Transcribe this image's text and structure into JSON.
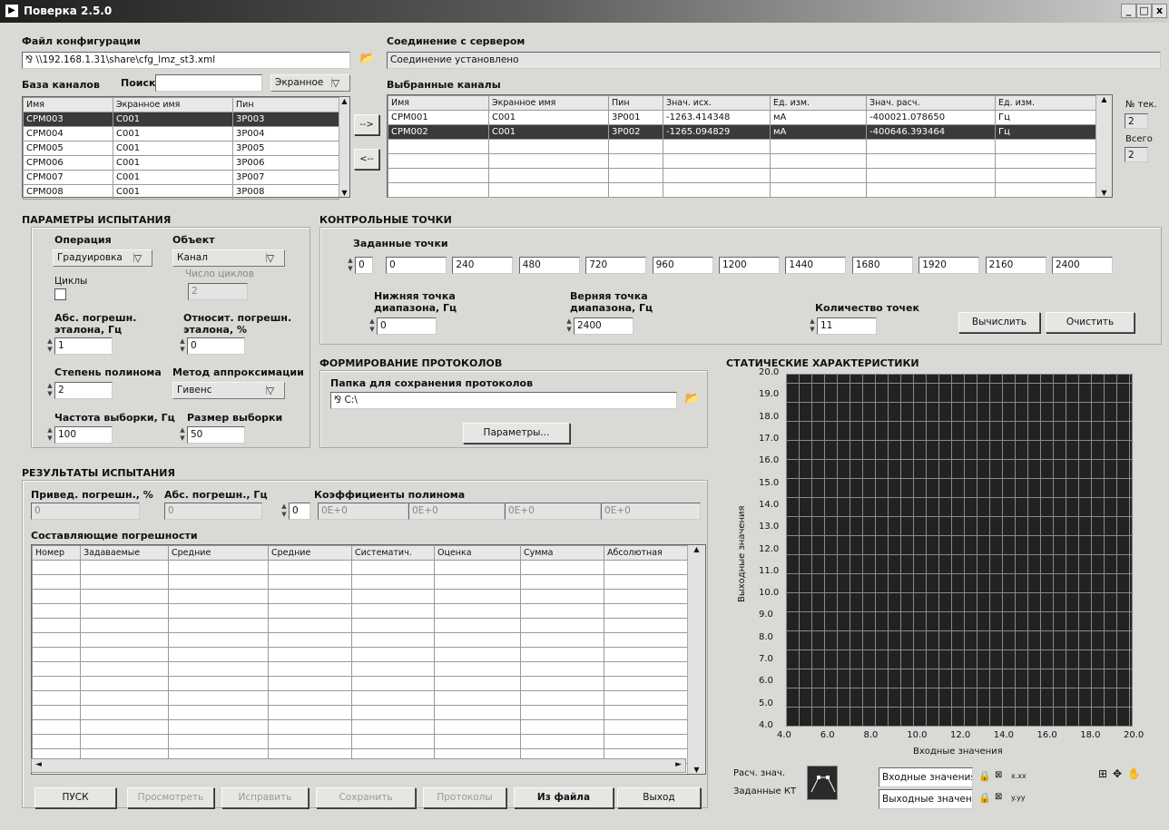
{
  "window": {
    "title": "Поверка 2.5.0",
    "min": "_",
    "max": "□",
    "close": "x"
  },
  "config": {
    "label": "Файл конфигурации",
    "path": "\\\\192.168.1.31\\share\\cfg_lmz_st3.xml"
  },
  "server": {
    "label": "Соединение с сервером",
    "status": "Соединение установлено"
  },
  "base": {
    "label": "База каналов",
    "search_label": "Поиск",
    "search_value": "",
    "filter": "Экранное",
    "columns": [
      "Имя",
      "Экранное имя",
      "Пин"
    ],
    "rows": [
      [
        "CPM003",
        "C001",
        "3P003"
      ],
      [
        "CPM004",
        "C001",
        "3P004"
      ],
      [
        "CPM005",
        "C001",
        "3P005"
      ],
      [
        "CPM006",
        "C001",
        "3P006"
      ],
      [
        "CPM007",
        "C001",
        "3P007"
      ],
      [
        "CPM008",
        "C001",
        "3P008"
      ]
    ]
  },
  "transfer": {
    "add": "-->",
    "remove": "<--"
  },
  "selected": {
    "label": "Выбранные каналы",
    "columns": [
      "Имя",
      "Экранное имя",
      "Пин",
      "Знач. исх.",
      "Ед. изм.",
      "Знач. расч.",
      "Ед. изм."
    ],
    "rows": [
      [
        "CPM001",
        "C001",
        "3P001",
        "-1263.414348",
        "мА",
        "-400021.078650",
        "Гц"
      ],
      [
        "CPM002",
        "C001",
        "3P002",
        "-1265.094829",
        "мА",
        "-400646.393464",
        "Гц"
      ]
    ],
    "cur_label": "№ тек.",
    "cur": "2",
    "total_label": "Всего",
    "total": "2"
  },
  "params": {
    "section": "ПАРАМЕТРЫ ИСПЫТАНИЯ",
    "op_label": "Операция",
    "op": "Градуировка",
    "obj_label": "Объект",
    "obj": "Канал",
    "cycles_label": "Циклы",
    "cycles_count_label": "Число циклов",
    "cycles_count": "2",
    "abs_label": "Абс. погрешн. эталона, Гц",
    "abs": "1",
    "rel_label": "Относит. погрешн. эталона, %",
    "rel": "0",
    "deg_label": "Степень полинома",
    "deg": "2",
    "method_label": "Метод аппроксимации",
    "method": "Гивенс",
    "freq_label": "Частота выборки, Гц",
    "freq": "100",
    "size_label": "Размер выборки",
    "size": "50"
  },
  "points": {
    "section": "КОНТРОЛЬНЫЕ ТОЧКИ",
    "label": "Заданные точки",
    "index": "0",
    "values": [
      "0",
      "240",
      "480",
      "720",
      "960",
      "1200",
      "1440",
      "1680",
      "1920",
      "2160",
      "2400"
    ],
    "low_label": "Нижняя точка диапазона, Гц",
    "low": "0",
    "high_label": "Верняя точка диапазона, Гц",
    "high": "2400",
    "count_label": "Количество точек",
    "count": "11",
    "calc": "Вычислить",
    "clear": "Очистить"
  },
  "protocols": {
    "section": "ФОРМИРОВАНИЕ ПРОТОКОЛОВ",
    "folder_label": "Папка для сохранения протоколов",
    "folder": "C:\\",
    "params_btn": "Параметры..."
  },
  "results": {
    "section": "РЕЗУЛЬТАТЫ ИСПЫТАНИЯ",
    "red_label": "Привед. погрешн., %",
    "red": "0",
    "abs_label": "Абс. погрешн., Гц",
    "abs": "0",
    "coef_label": "Коэффициенты полинома",
    "coef_index": "0",
    "coefs": [
      "0E+0",
      "0E+0",
      "0E+0",
      "0E+0"
    ],
    "comp_label": "Составляющие погрешности",
    "columns": [
      "Номер",
      "Задаваемые",
      "Средние",
      "Средние",
      "Систематич.",
      "Оценка",
      "Сумма",
      "Абсолютная"
    ]
  },
  "buttons": {
    "start": "ПУСК",
    "view": "Просмотреть",
    "fix": "Исправить",
    "save": "Сохранить",
    "protocols": "Протоколы",
    "from_file": "Из файла",
    "exit": "Выход"
  },
  "chart_data": {
    "type": "line",
    "title": "СТАТИЧЕСКИЕ ХАРАКТЕРИСТИКИ",
    "xlabel": "Входные значения",
    "ylabel": "Выходные значения",
    "xlim": [
      4.0,
      20.0
    ],
    "ylim": [
      4.0,
      20.0
    ],
    "xticks": [
      "4.0",
      "6.0",
      "8.0",
      "10.0",
      "12.0",
      "14.0",
      "16.0",
      "18.0",
      "20.0"
    ],
    "yticks": [
      "20.0",
      "19.0",
      "18.0",
      "17.0",
      "16.0",
      "15.0",
      "14.0",
      "13.0",
      "12.0",
      "11.0",
      "10.0",
      "9.0",
      "8.0",
      "7.0",
      "6.0",
      "5.0",
      "4.0"
    ],
    "grid": true,
    "series": []
  },
  "legend": {
    "calc": "Расч. знач.",
    "set": "Заданные КТ",
    "x_axis": "Входные значения",
    "y_axis": "Выходные значения",
    "x_fmt": "x.xx",
    "y_fmt": "y.yy"
  }
}
